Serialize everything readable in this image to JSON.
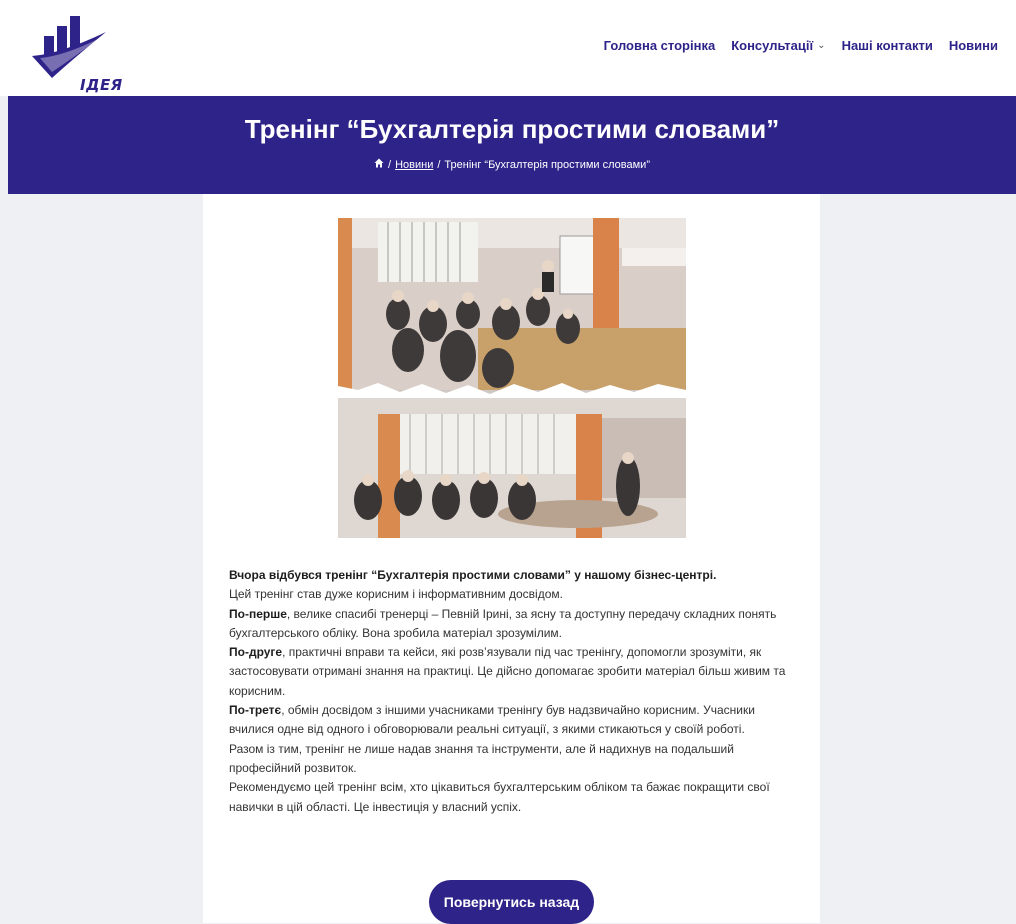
{
  "brand": {
    "logo_text": "ІДЕЯ",
    "accent": "#2e2389"
  },
  "nav": {
    "items": [
      {
        "label": "Головна сторінка"
      },
      {
        "label": "Консультації",
        "has_dropdown": true
      },
      {
        "label": "Наші контакти"
      },
      {
        "label": "Новини"
      }
    ]
  },
  "hero": {
    "title": "Тренінг “Бухгалтерія простими словами”",
    "breadcrumb": {
      "home_icon": "home-icon",
      "sep": "/",
      "link": "Новини",
      "current": "Тренінг “Бухгалтерія простими словами”"
    }
  },
  "article": {
    "lines": [
      {
        "bold": "Вчора відбувся тренінг “Бухгалтерія простими словами” у нашому бізнес-центрі.",
        "text": ""
      },
      {
        "bold": "",
        "text": "Цей тренінг став дуже корисним і інформативним досвідом."
      },
      {
        "bold": "По-перше",
        "text": ", велике спасибі тренерці – Певній Ірині, за ясну та доступну передачу складних понять бухгалтерського обліку. Вона зробила матеріал зрозумілим."
      },
      {
        "bold": "По-друге",
        "text": ", практичні вправи та кейси, які розв’язували під час тренінгу, допомогли зрозуміти, як застосовувати отримані знання на практиці. Це дійсно допомагає зробити матеріал більш живим та корисним."
      },
      {
        "bold": "По-третє",
        "text": ", обмін досвідом з іншими учасниками тренінгу був надзвичайно корисним. Учасники вчилися одне від одного і обговорювали реальні ситуації, з якими стикаються у своїй роботі."
      },
      {
        "bold": "",
        "text": "Разом із тим, тренінг не лише надав знання та інструменти, але й надихнув на подальший професійний розвиток."
      },
      {
        "bold": "",
        "text": "Рекомендуємо цей тренінг всім, хто цікавиться бухгалтерським обліком та бажає покращити свої навички в цій області. Це інвестиція у власний успіх."
      }
    ],
    "back_button": "Повернутись назад"
  }
}
